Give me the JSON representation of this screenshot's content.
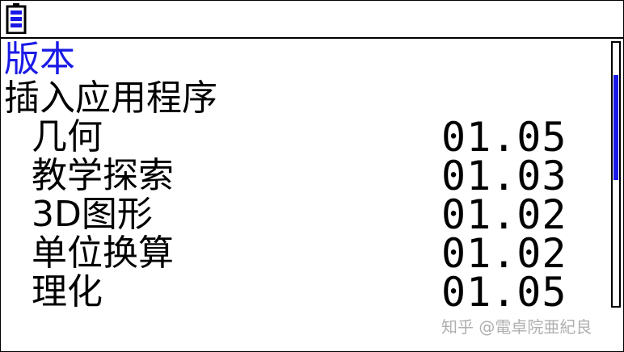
{
  "statusbar": {
    "battery_icon": "battery-icon"
  },
  "screen": {
    "title": "版本",
    "section": "插入应用程序",
    "apps": [
      {
        "name": "几何",
        "version": "01.05"
      },
      {
        "name": "教学探索",
        "version": "01.03"
      },
      {
        "name": "3D图形",
        "version": "01.02"
      },
      {
        "name": "单位换算",
        "version": "01.02"
      },
      {
        "name": "理化",
        "version": "01.05"
      }
    ]
  },
  "colors": {
    "accent": "#1a1ae6",
    "text": "#000000",
    "background": "#ffffff"
  },
  "watermark": "知乎 @電卓院亜紀良"
}
